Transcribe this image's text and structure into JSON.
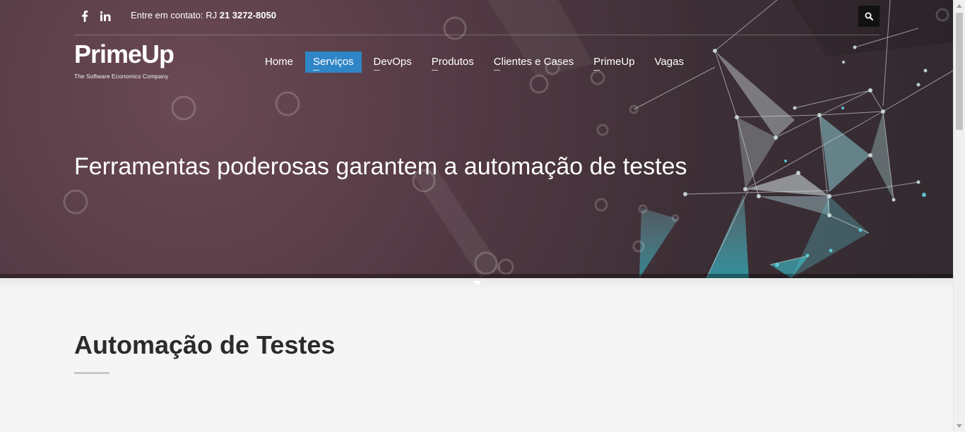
{
  "topbar": {
    "facebook_icon": "facebook-icon",
    "linkedin_icon": "linkedin-icon",
    "contact_prefix": "Entre em contato: RJ ",
    "contact_phone": "21 3272-8050",
    "search_icon": "search-icon"
  },
  "logo": {
    "wordmark": "PrimeUp",
    "tagline": "The Software Economics Company"
  },
  "nav": {
    "items": [
      {
        "label": "Home",
        "active": false
      },
      {
        "label": "Serviços",
        "active": true
      },
      {
        "label": "DevOps",
        "active": false
      },
      {
        "label": "Produtos",
        "active": false
      },
      {
        "label": "Clientes e Cases",
        "active": false
      },
      {
        "label": "PrimeUp",
        "active": false
      },
      {
        "label": "Vagas",
        "active": false
      }
    ]
  },
  "hero": {
    "title": "Ferramentas poderosas garantem a automação de testes"
  },
  "main": {
    "section_title": "Automação de Testes"
  },
  "colors": {
    "nav_active": "#2f86c6",
    "hero_bg": "#533a44",
    "accent_cyan": "#3fc6d4",
    "page_bg": "#f5f5f5"
  }
}
